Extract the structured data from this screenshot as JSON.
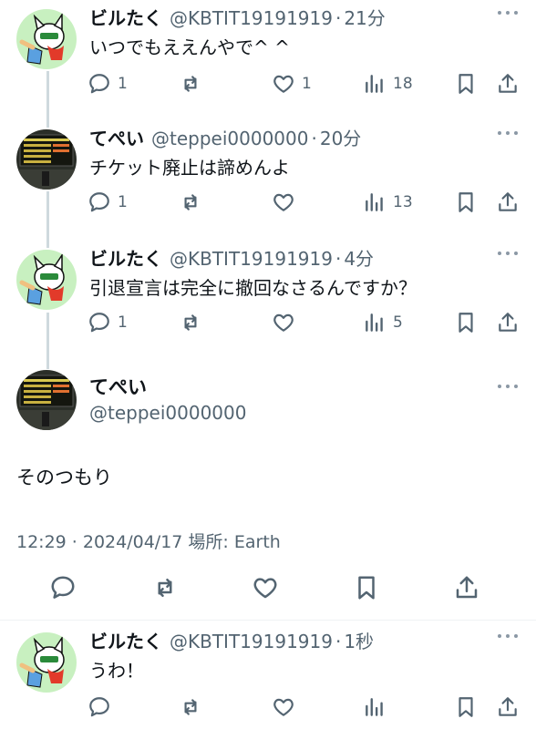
{
  "tweets": [
    {
      "name": "ビルたく",
      "handle": "@KBTIT19191919",
      "time": "21分",
      "text": "いつでもええんやで^ ^",
      "replies": "1",
      "retweets": "",
      "likes": "1",
      "views": "18",
      "avatar": "character"
    },
    {
      "name": "てぺい",
      "handle": "@teppei0000000",
      "time": "20分",
      "text": "チケット廃止は諦めんよ",
      "replies": "1",
      "retweets": "",
      "likes": "",
      "views": "13",
      "avatar": "board"
    },
    {
      "name": "ビルたく",
      "handle": "@KBTIT19191919",
      "time": "4分",
      "text": "引退宣言は完全に撤回なさるんですか？",
      "replies": "1",
      "retweets": "",
      "likes": "",
      "views": "5",
      "avatar": "character"
    }
  ],
  "focused": {
    "name": "てぺい",
    "handle": "@teppei0000000",
    "text": "そのつもり",
    "meta": "12:29 · 2024/04/17 場所: Earth",
    "avatar": "board"
  },
  "reply": {
    "name": "ビルたく",
    "handle": "@KBTIT19191919",
    "time": "1秒",
    "text": "うわ！",
    "replies": "",
    "retweets": "",
    "likes": "",
    "views": "",
    "avatar": "character"
  },
  "separator": "·",
  "icons": {
    "reply": "speech-bubble-icon",
    "retweet": "retweet-arrows-icon",
    "like": "heart-icon",
    "views": "bar-chart-icon",
    "bookmark": "bookmark-icon",
    "share": "share-upload-icon",
    "more": "three-dots-icon"
  },
  "colors": {
    "text": "#0f1419",
    "muted": "#536471",
    "thread_line": "#cfd9de"
  }
}
